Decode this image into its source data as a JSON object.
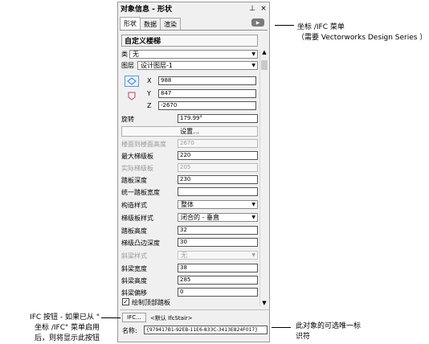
{
  "palette": {
    "title": "对象信息 - 形状",
    "pin_icon": "pin-icon",
    "close_icon": "close-icon"
  },
  "tabs": [
    {
      "label": "形状",
      "active": true
    },
    {
      "label": "数据",
      "active": false
    },
    {
      "label": "渲染",
      "active": false
    }
  ],
  "section_title": "自定义楼梯",
  "class_row": {
    "label": "类",
    "value": "无"
  },
  "layer_row": {
    "label": "图层",
    "value": "设计图层-1"
  },
  "coords": {
    "x_label": "X",
    "x_value": "988",
    "y_label": "Y",
    "y_value": "847",
    "z_label": "Z",
    "z_value": "-2670"
  },
  "rotation": {
    "label": "旋转",
    "value": "179.99°"
  },
  "settings_button": "设置...",
  "params": [
    {
      "label": "楼面到楼面高度",
      "value": "2670",
      "disabled": true,
      "type": "field"
    },
    {
      "label": "最大梯级板",
      "value": "220",
      "disabled": false,
      "type": "field"
    },
    {
      "label": "实际梯级板",
      "value": "205",
      "disabled": true,
      "type": "field"
    },
    {
      "label": "踏板深度",
      "value": "230",
      "disabled": false,
      "type": "field"
    },
    {
      "label": "统一踏板宽度",
      "value": "",
      "disabled": false,
      "type": "field"
    },
    {
      "label": "构造样式",
      "value": "整体",
      "disabled": false,
      "type": "combo"
    },
    {
      "label": "梯级板样式",
      "value": "闭合的 - 垂直",
      "disabled": false,
      "type": "combo"
    },
    {
      "label": "踏板高度",
      "value": "32",
      "disabled": false,
      "type": "field"
    },
    {
      "label": "梯级凸边深度",
      "value": "30",
      "disabled": false,
      "type": "field"
    },
    {
      "label": "斜梁样式",
      "value": "无",
      "disabled": true,
      "type": "combo"
    },
    {
      "label": "斜梁宽度",
      "value": "38",
      "disabled": false,
      "type": "field"
    },
    {
      "label": "斜梁高度",
      "value": "285",
      "disabled": false,
      "type": "field"
    },
    {
      "label": "斜梁偏移",
      "value": "0",
      "disabled": false,
      "type": "field"
    }
  ],
  "checkbox": {
    "label": "绘制顶部踏板",
    "checked": true
  },
  "ifc": {
    "button_label": "IFC...",
    "type_text": "<默认 IfcStair>"
  },
  "name_row": {
    "label": "名称:",
    "value": "{979417B1-92EB-11E6-833C-3413E824F017}"
  },
  "callouts": {
    "top_line1": "坐标 /IFC 菜单",
    "top_line2": "（需要 Vectorworks Design Series ）",
    "left_line1": "IFC 按钮 - 如果已从 \"",
    "left_line2": "坐标 /IFC\" 菜单启用",
    "left_line3": "后，则将显示此按钮",
    "right_line1": "此对象的可选唯一标",
    "right_line2": "识符"
  }
}
